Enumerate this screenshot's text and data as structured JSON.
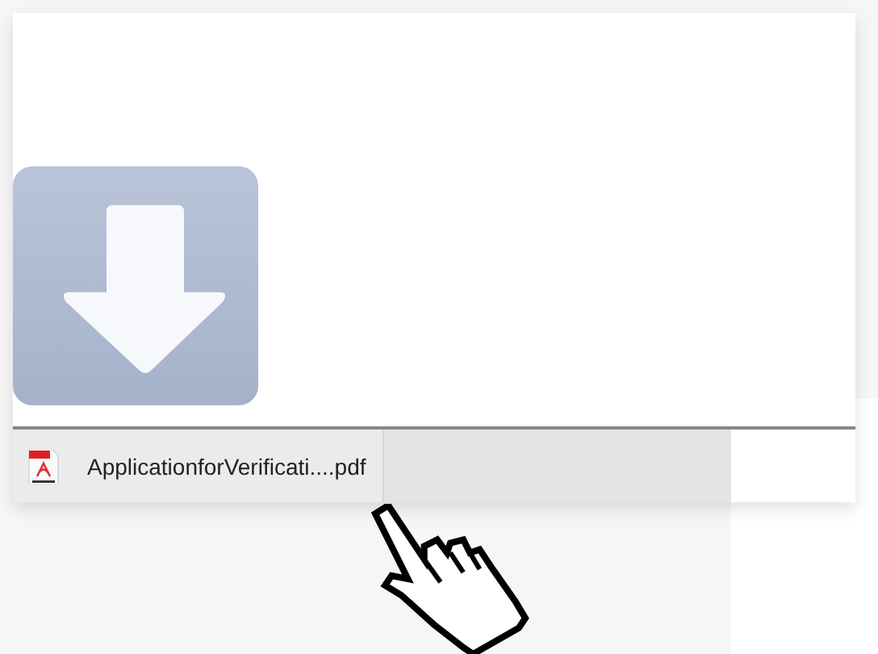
{
  "download_bar": {
    "items": [
      {
        "file_name": "ApplicationforVerificati....pdf"
      }
    ]
  }
}
